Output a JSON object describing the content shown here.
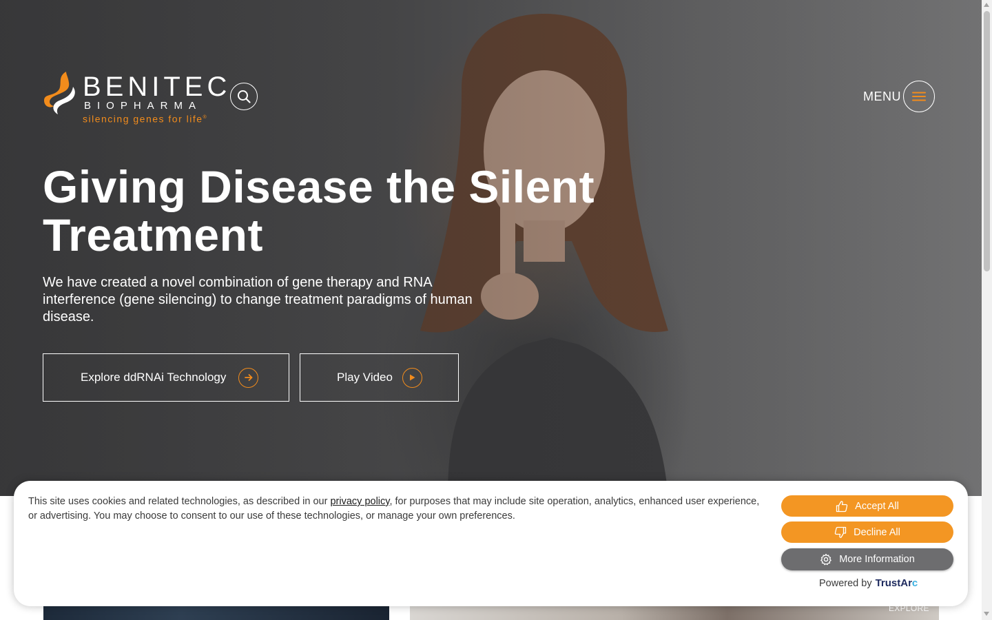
{
  "brand": {
    "name": "BENITEC",
    "sub": "BIOPHARMA",
    "tagline": "silencing genes for life",
    "trademark": "®",
    "accent_color": "#f28c1c"
  },
  "header": {
    "menu_label": "MENU"
  },
  "hero": {
    "title": "Giving Disease the Silent Treatment",
    "description": "We have created a novel combination of gene therapy and RNA interference (gene silencing) to change treatment paradigms of human disease.",
    "buttons": {
      "explore": "Explore ddRNAi Technology",
      "video": "Play Video"
    }
  },
  "below": {
    "explore_label": "EXPLORE"
  },
  "cookie": {
    "text_before": "This site uses cookies and related technologies, as described in our ",
    "link": "privacy policy",
    "text_after": ", for purposes that may include site operation, analytics, enhanced user experience, or advertising. You may choose to consent to our use of these technologies, or manage your own preferences.",
    "accept": "Accept All",
    "decline": "Decline All",
    "more": "More Information",
    "powered_by": "Powered by",
    "provider_main": "TrustAr",
    "provider_end": "c",
    "button_color": "#f39623",
    "more_color": "#6d6d6f"
  }
}
